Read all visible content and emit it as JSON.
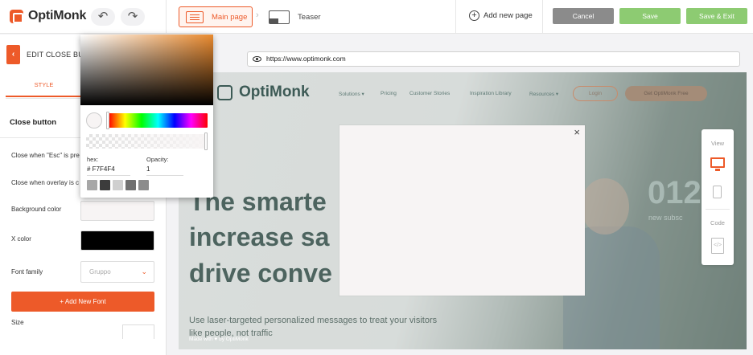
{
  "app": {
    "logo_text": "OptiMonk",
    "undo_icon": "undo-icon",
    "redo_icon": "redo-icon"
  },
  "pages": {
    "main_page_label": "Main page",
    "teaser_label": "Teaser",
    "separator": "›",
    "add_new_page_label": "Add new page"
  },
  "actions": {
    "cancel_label": "Cancel",
    "save_label": "Save",
    "save_exit_label": "Save & Exit"
  },
  "panel": {
    "back_icon": "chevron-left-icon",
    "title": "EDIT CLOSE BU",
    "tab_style": "STYLE",
    "section_title": "Close button",
    "rows": {
      "esc_label": "Close when \"Esc\" is pre",
      "overlay_label": "Close when overlay is c",
      "background_color_label": "Background color",
      "x_color_label": "X color",
      "font_family_label": "Font family",
      "size_label": "Size"
    },
    "background_color_value": "#F7F4F4",
    "x_color_value": "#000000",
    "font_family_value": "Gruppo",
    "add_font_label": "+ Add New Font"
  },
  "color_picker": {
    "hex_label": "hex:",
    "hex_value": "# F7F4F4",
    "opacity_label": "Opacity:",
    "opacity_value": "1",
    "preset_colors": [
      "#a7a7a7",
      "#3c3c3c",
      "#cfcfcf",
      "#707070",
      "#8c8c8c"
    ],
    "saturation_hue": "#e98a2f"
  },
  "browser": {
    "url": "https://www.optimonk.com"
  },
  "site": {
    "logo_text": "OptiMonk",
    "nav": {
      "solutions": "Solutions ▾",
      "pricing": "Pricing",
      "customer_stories": "Customer Stories",
      "inspiration_library": "Inspiration Library",
      "resources": "Resources ▾"
    },
    "login_label": "Login",
    "trial_label": "Get OptiMonk Free",
    "hero_line1": "The smarte",
    "hero_line2": "increase sa",
    "hero_line3": "drive conve",
    "hero_sub_line1": "Use laser-targeted personalized messages to treat your visitors",
    "hero_sub_line2": "like people, not traffic",
    "big_number": "012",
    "new_subs": "new subsc",
    "made_with": "Made with ♥ by OptiMonk"
  },
  "popup": {
    "close_glyph": "×",
    "background": "#F7F4F4"
  },
  "right_toolbar": {
    "view_label": "View",
    "code_label": "Code",
    "desktop_icon": "desktop-icon",
    "mobile_icon": "mobile-icon",
    "code_icon": "code-file-icon"
  },
  "colors": {
    "accent": "#ed5a29",
    "save_green": "#8dcb72",
    "cancel_gray": "#8b8b8b"
  }
}
